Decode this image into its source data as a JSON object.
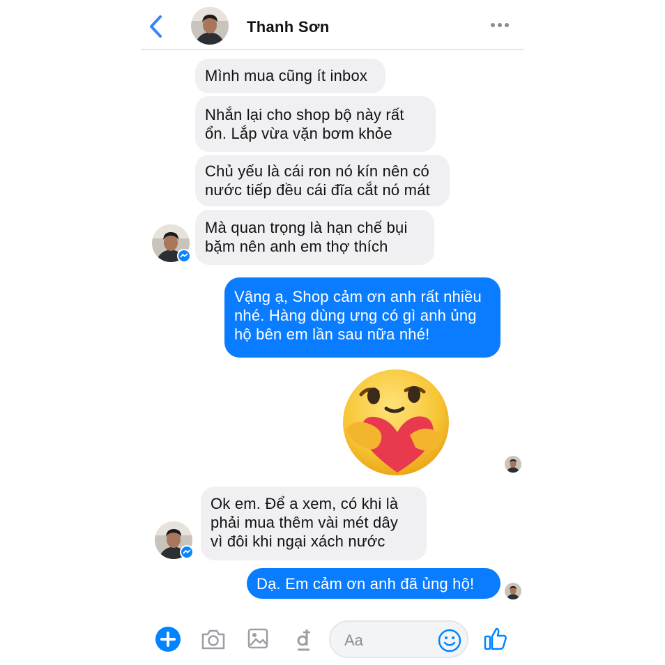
{
  "header": {
    "contact_name": "Thanh Sơn"
  },
  "messages": [
    {
      "from": "contact",
      "text": "Mình mua cũng ít inbox"
    },
    {
      "from": "contact",
      "text": "Nhắn lại cho shop bộ này rất\nổn. Lắp vừa vặn bơm khỏe"
    },
    {
      "from": "contact",
      "text": "Chủ yếu là cái ron nó kín nên có\nnước tiếp đều cái đĩa cắt nó mát"
    },
    {
      "from": "contact",
      "text": "Mà quan trọng là hạn chế bụi\nbặm nên anh em thợ thích"
    },
    {
      "from": "me",
      "text": "Vậng ạ, Shop cảm ơn anh rất nhiều\nnhé. Hàng dùng ưng có gì anh ủng\nhộ bên em lần sau nữa nhé!"
    },
    {
      "from": "me",
      "sticker": "care-reaction-sticker"
    },
    {
      "from": "contact",
      "text": "Ok em. Để a xem, có khi là\nphải mua thêm vài mét dây\nvì đôi khi ngại xách nước"
    },
    {
      "from": "me",
      "text": "Dạ. Em cảm ơn anh đã ủng hộ!"
    }
  ],
  "composer": {
    "placeholder": "Aa",
    "tools": [
      "plus-icon",
      "camera-icon",
      "photo-icon",
      "payment-dong-icon",
      "emoji-icon",
      "thumbs-up-icon"
    ]
  },
  "colors": {
    "accent": "#0a7cff",
    "incoming_bubble": "#f0f0f2",
    "icon_blue": "#0084ff"
  }
}
